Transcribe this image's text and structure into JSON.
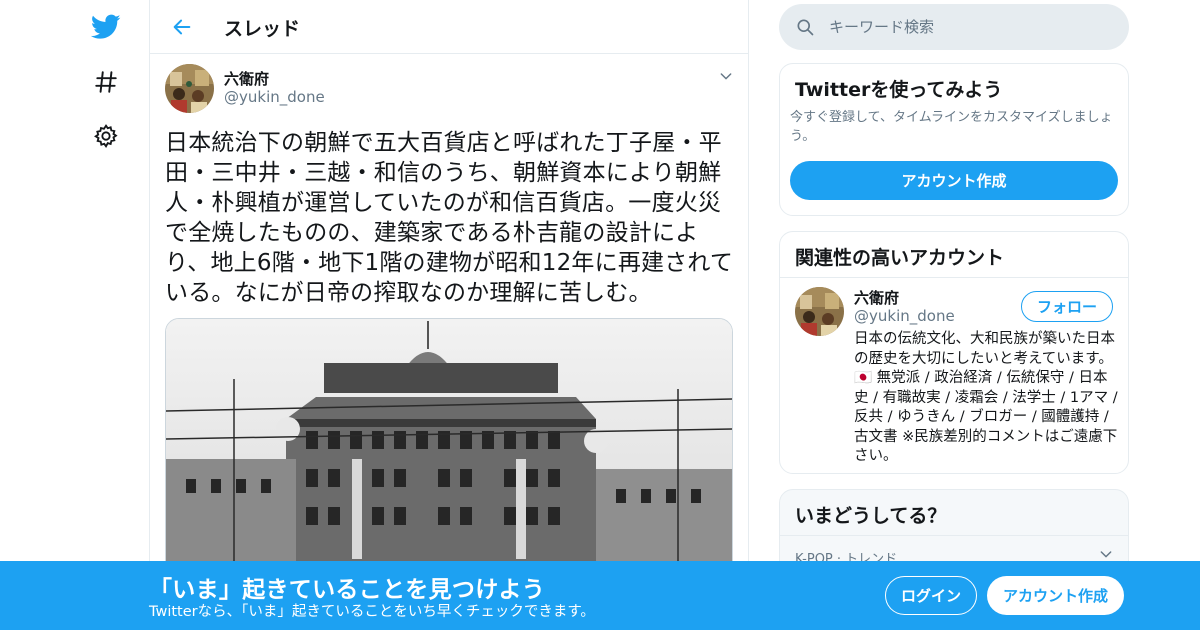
{
  "nav": {
    "items": [
      {
        "icon": "twitter-bird-icon"
      },
      {
        "icon": "hashtag-icon"
      },
      {
        "icon": "gear-icon"
      }
    ]
  },
  "header": {
    "title": "スレッド"
  },
  "tweet": {
    "author_name": "六衛府",
    "author_handle": "@yukin_done",
    "text": "日本統治下の朝鮮で五大百貨店と呼ばれた丁子屋・平田・三中井・三越・和信のうち、朝鮮資本により朝鮮人・朴興植が運営していたのが和信百貨店。一度火災で全焼したものの、建築家である朴吉龍の設計により、地上6階・地下1階の建物が昭和12年に再建されている。なにが日帝の搾取なのか理解に苦しむ。"
  },
  "search": {
    "placeholder": "キーワード検索"
  },
  "signup_card": {
    "title": "Twitterを使ってみよう",
    "desc": "今すぐ登録して、タイムラインをカスタマイズしましょう。",
    "button": "アカウント作成"
  },
  "related": {
    "title": "関連性の高いアカウント",
    "name": "六衛府",
    "handle": "@yukin_done",
    "follow": "フォロー",
    "bio": "日本の伝統文化、大和民族が築いた日本の歴史を大切にしたいと考えています。🇯🇵 無党派 / 政治経済 / 伝統保守 / 日本史 / 有職故実 / 凌霜会 / 法学士 / 1アマ / 反共 / ゆうきん / ブロガー / 國體護持 / 古文書 ※民族差別的コメントはご遠慮下さい。"
  },
  "trends": {
    "title": "いまどうしてる？",
    "first_meta": "K-POP · トレンド"
  },
  "bottom_bar": {
    "title": "「いま」起きていることを見つけよう",
    "subtitle": "Twitterなら、「いま」起きていることをいち早くチェックできます。",
    "login": "ログイン",
    "signup": "アカウント作成"
  },
  "colors": {
    "accent": "#1da1f2",
    "border": "#e6ecf0",
    "secondary_text": "#657786"
  }
}
